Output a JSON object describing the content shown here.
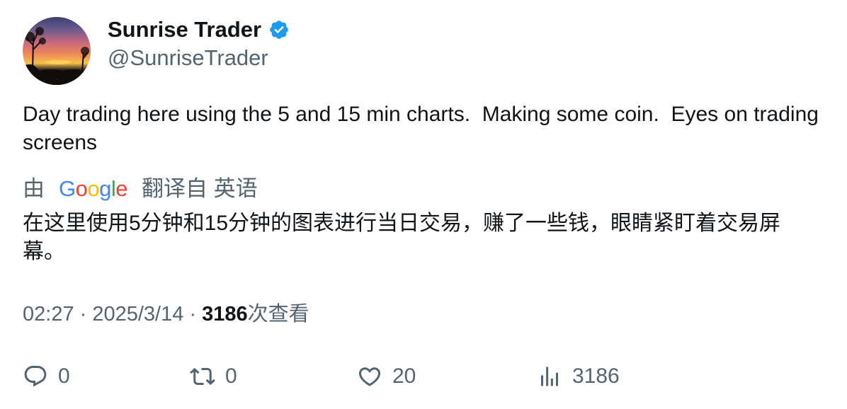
{
  "author": {
    "display_name": "Sunrise Trader",
    "handle": "@SunriseTrader",
    "verified_icon": "verified-badge-icon",
    "verified_color": "#1d9bf0"
  },
  "tweet": {
    "text": "Day trading here using the 5 and 15 min charts.  Making some coin.  Eyes on trading screens"
  },
  "translation": {
    "prefix": "由",
    "provider": "Google",
    "suffix": "翻译自 英语",
    "text": "在这里使用5分钟和15分钟的图表进行当日交易，赚了一些钱，眼睛紧盯着交易屏幕。"
  },
  "meta": {
    "time": "02:27",
    "separator": "·",
    "date": "2025/3/14",
    "views_count": "3186",
    "views_label": "次查看"
  },
  "actions": {
    "reply_count": "0",
    "retweet_count": "0",
    "like_count": "20",
    "views_count": "3186"
  },
  "colors": {
    "text_primary": "#0f1419",
    "text_secondary": "#536471"
  }
}
